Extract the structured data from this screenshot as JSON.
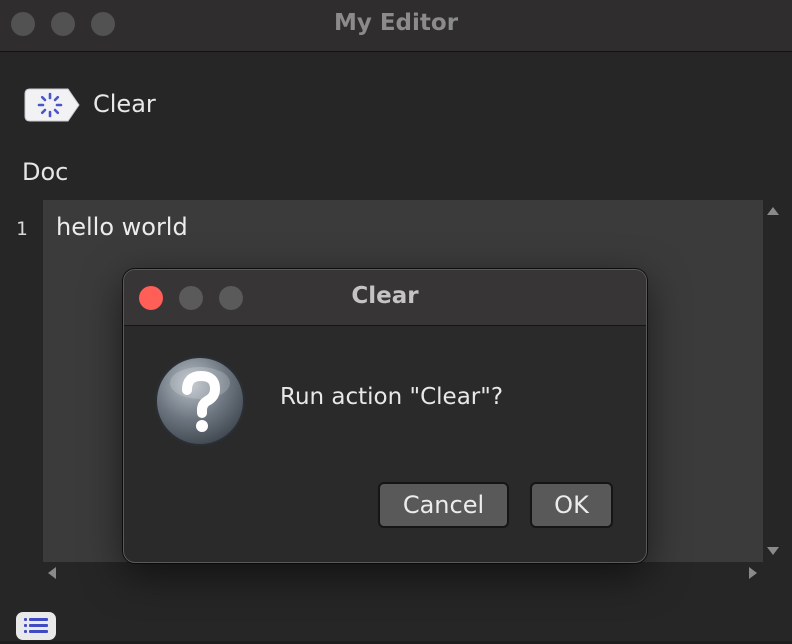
{
  "window": {
    "title": "My Editor"
  },
  "toolbar": {
    "action_label": "Clear",
    "action_icon": "spinner-badge-icon"
  },
  "document": {
    "label": "Doc",
    "lines": [
      {
        "number": "1",
        "text": "hello world"
      }
    ]
  },
  "dialog": {
    "title": "Clear",
    "message": "Run action \"Clear\"?",
    "icon": "question-icon",
    "cancel_label": "Cancel",
    "ok_label": "OK"
  },
  "colors": {
    "close_red": "#ff5f57",
    "window_bg": "#262626",
    "editor_bg": "#3b3b3b",
    "button_bg": "#5a595a"
  },
  "footer": {
    "icon": "list-icon"
  }
}
